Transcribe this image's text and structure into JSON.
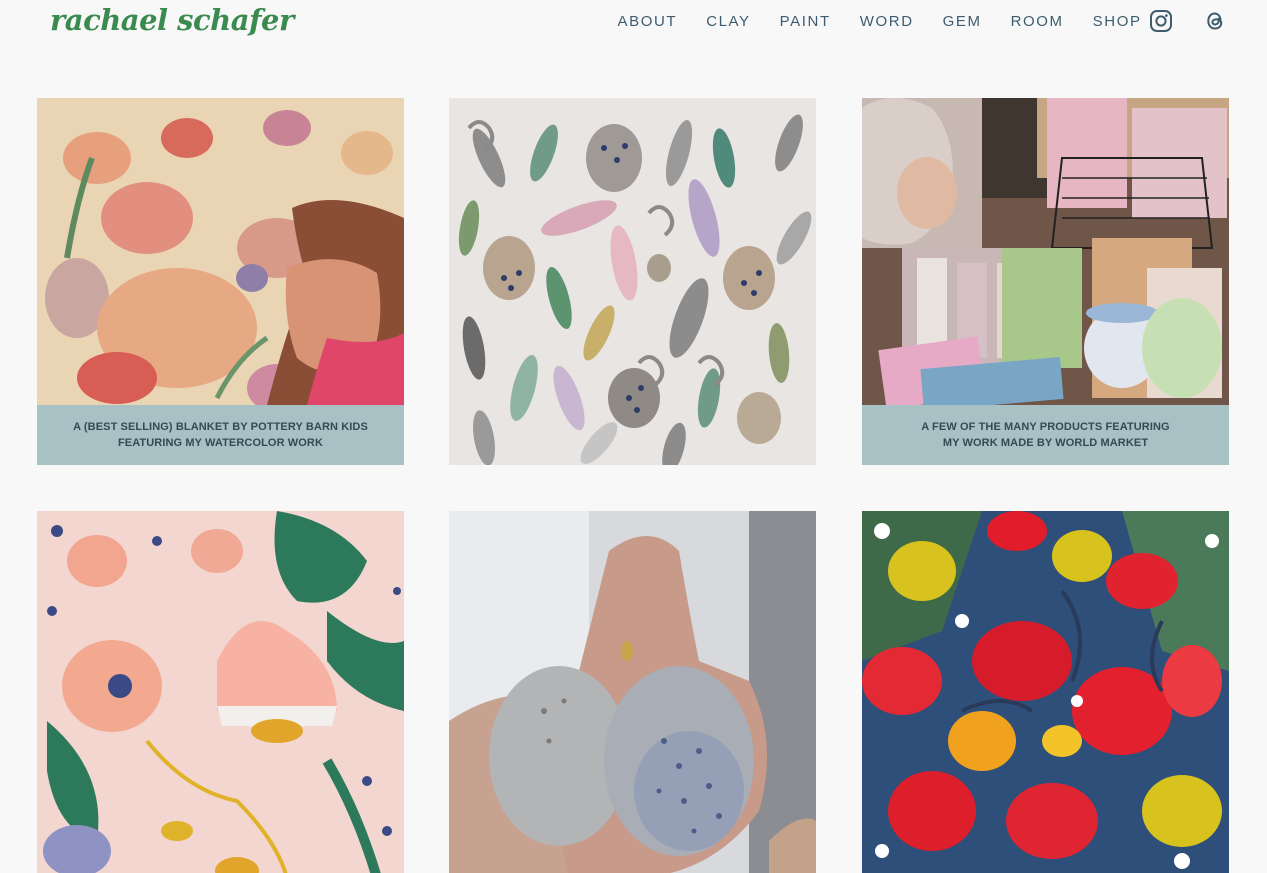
{
  "site": {
    "logo_text": "rachael schafer"
  },
  "nav": {
    "items": [
      "ABOUT",
      "CLAY",
      "PAINT",
      "WORD",
      "GEM",
      "ROOM",
      "SHOP"
    ]
  },
  "social": {
    "icons": [
      "instagram-icon",
      "threads-icon"
    ]
  },
  "gallery": {
    "tiles": [
      {
        "image": "quilted-floral-blanket-with-child",
        "caption_lines": [
          "A (BEST SELLING) BLANKET BY POTTERY BARN KIDS",
          "FEATURING MY WATERCOLOR WORK"
        ]
      },
      {
        "image": "watercolor-feathers-and-eggs-pattern",
        "caption_lines": []
      },
      {
        "image": "world-market-products-with-artist",
        "caption_lines": [
          "A FEW OF THE MANY PRODUCTS FEATURING",
          "MY WORK MADE BY WORLD MARKET"
        ]
      },
      {
        "image": "pink-floral-folk-illustration",
        "caption_lines": []
      },
      {
        "image": "hand-holding-two-ceramic-eggs",
        "caption_lines": []
      },
      {
        "image": "red-and-yellow-tropical-flowers-painting",
        "caption_lines": []
      }
    ]
  },
  "colors": {
    "background": "#f8f8f8",
    "logo_green": "#3b8a4f",
    "nav_text": "#3e5c6f",
    "caption_band": "#a8c1c4",
    "caption_text": "#344a57"
  }
}
